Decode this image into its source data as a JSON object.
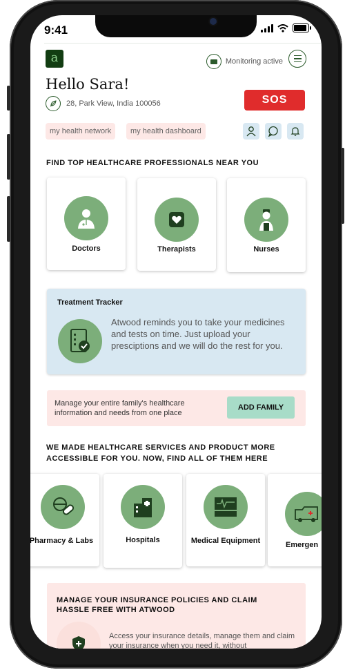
{
  "status": {
    "time": "9:41"
  },
  "header": {
    "logo_letter": "a",
    "monitoring": "Monitoring active"
  },
  "greeting": {
    "hello": "Hello Sara!",
    "address": "28, Park View, India 100056",
    "sos_label": "SOS"
  },
  "quick_links": {
    "network": "my health network",
    "dashboard": "my health dashboard"
  },
  "professionals": {
    "title": "FIND TOP HEALTHCARE PROFESSIONALS NEAR YOU",
    "items": [
      {
        "label": "Doctors",
        "icon": "doctor-icon"
      },
      {
        "label": "Therapists",
        "icon": "heart-icon"
      },
      {
        "label": "Nurses",
        "icon": "nurse-icon"
      }
    ]
  },
  "tracker": {
    "title": "Treatment Tracker",
    "text": "Atwood reminds you to take your medicines and tests on time. Just upload your presciptions and we will do the rest for you.",
    "icon": "checklist-icon"
  },
  "family": {
    "text": "Manage your entire family's healthcare information and needs from one place",
    "button": "ADD FAMILY"
  },
  "services": {
    "title_line1": "WE MADE HEALTHCARE SERVICES AND PRODUCT MORE",
    "title_line2": "ACCESSIBLE FOR YOU. NOW, FIND ALL OF THEM HERE",
    "items": [
      {
        "label": "Pharmacy & Labs",
        "icon": "pill-icon"
      },
      {
        "label": "Hospitals",
        "icon": "hospital-icon"
      },
      {
        "label": "Medical Equipment",
        "icon": "monitor-icon"
      },
      {
        "label": "Emergen",
        "icon": "ambulance-icon"
      }
    ]
  },
  "insurance": {
    "title": "MANAGE YOUR INSURANCE POLICIES AND CLAIM HASSLE FREE WITH ATWOOD",
    "text": "Access your insurance details, manage them and claim your insurance when you need it, without",
    "icon": "shield-icon"
  },
  "colors": {
    "brand_green": "#123d12",
    "icon_circle": "#7cae7a",
    "sos_red": "#e02c2c",
    "pink_bg": "#fde8e6",
    "blue_bg": "#d8e8f2",
    "mint_button": "#a8dcc8"
  }
}
